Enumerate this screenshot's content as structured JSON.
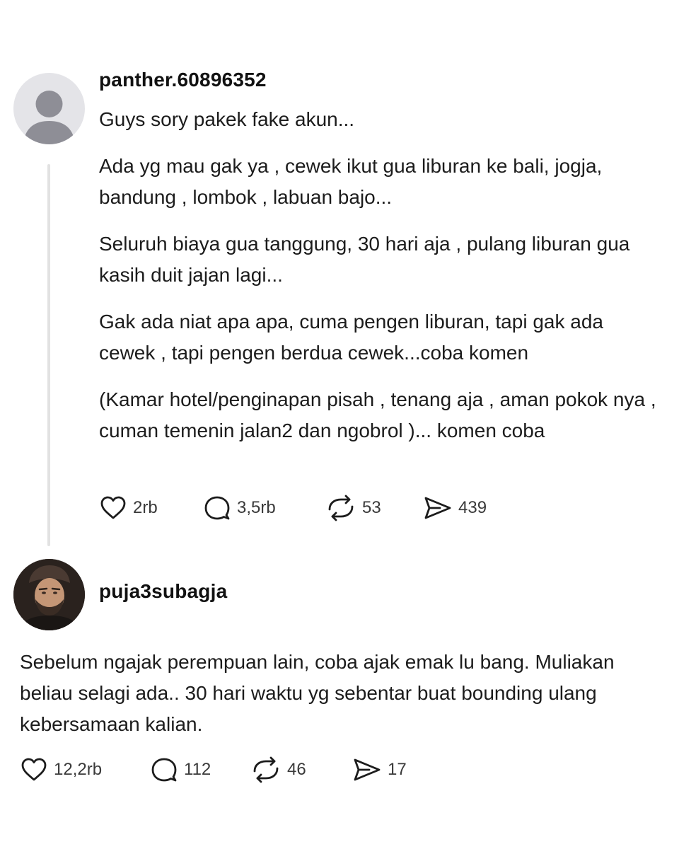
{
  "post": {
    "username": "panther.60896352",
    "paragraphs": [
      "Guys sory pakek fake akun...",
      "Ada yg mau gak ya , cewek ikut gua liburan ke bali, jogja, bandung , lombok , labuan bajo...",
      "Seluruh biaya gua tanggung, 30 hari aja , pulang liburan gua kasih duit jajan lagi...",
      "Gak ada niat apa apa, cuma pengen liburan, tapi gak ada cewek , tapi pengen berdua cewek...coba komen",
      "(Kamar hotel/penginapan pisah , tenang aja , aman pokok nya , cuman temenin jalan2 dan ngobrol )... komen coba"
    ],
    "stats": {
      "likes": "2rb",
      "replies": "3,5rb",
      "reposts": "53",
      "shares": "439"
    }
  },
  "reply": {
    "username": "puja3subagja",
    "text": "Sebelum ngajak perempuan lain, coba ajak emak lu bang. Muliakan beliau selagi ada.. 30 hari waktu yg sebentar buat bounding ulang kebersamaan kalian.",
    "stats": {
      "likes": "12,2rb",
      "replies": "112",
      "reposts": "46",
      "shares": "17"
    }
  },
  "icons": {
    "like": "heart-icon",
    "reply": "speech-bubble-icon",
    "repost": "repost-arrows-icon",
    "share": "send-paper-plane-icon"
  },
  "colors": {
    "text": "#1c1c1c",
    "muted": "#3a3a3a",
    "thread_line": "#e2e2e2",
    "avatar_placeholder": "#e4e4e8",
    "avatar_glyph": "#8e8e96"
  }
}
